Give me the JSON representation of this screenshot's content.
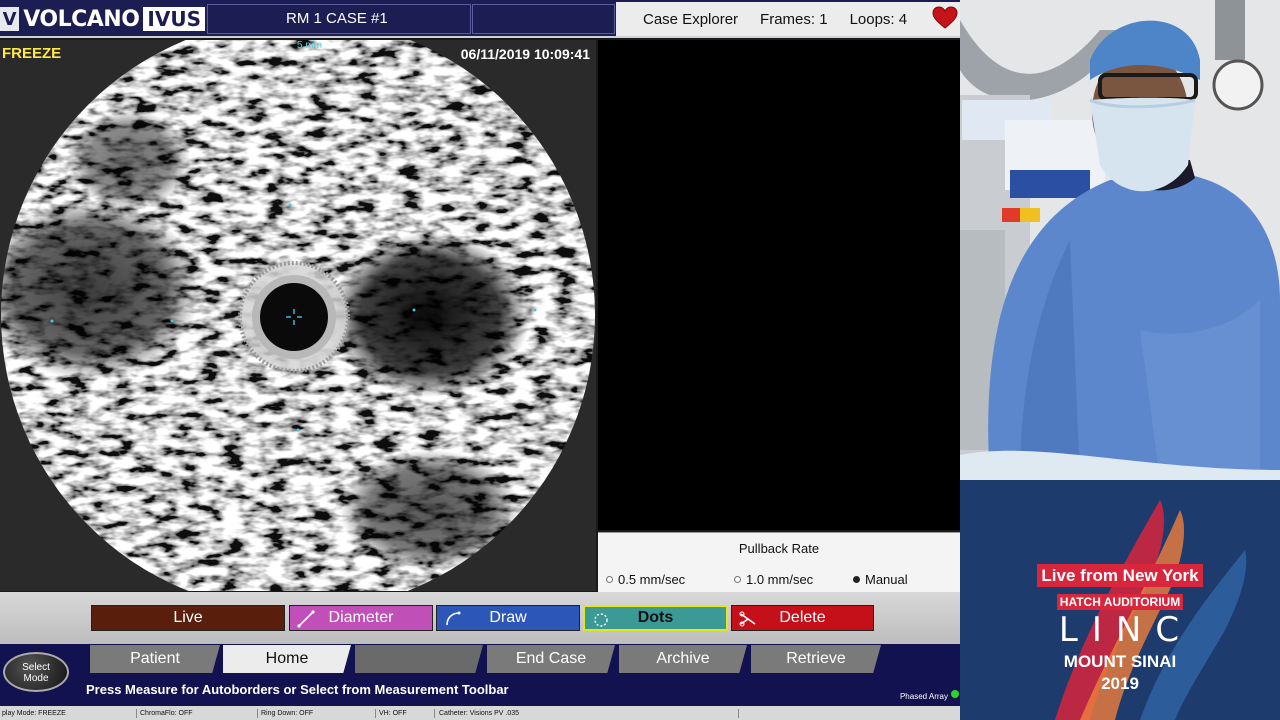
{
  "header": {
    "logo_badge": "V",
    "brand": "VOLCANO",
    "product": "IVUS",
    "case_title": "RM 1 CASE #1",
    "case_explorer_label": "Case Explorer",
    "frames_label": "Frames: 1",
    "loops_label": "Loops: 4"
  },
  "image_panel": {
    "mode": "FREEZE",
    "scale": "5 mm",
    "timestamp": "06/11/2019 10:09:41"
  },
  "pullback": {
    "title": "Pullback Rate",
    "options": [
      {
        "label": "0.5 mm/sec",
        "selected": false
      },
      {
        "label": "1.0 mm/sec",
        "selected": false
      },
      {
        "label": "Manual",
        "selected": true
      }
    ]
  },
  "toolbar": {
    "buttons": [
      {
        "label": "Live",
        "color": "#5a1f0c"
      },
      {
        "label": "Diameter",
        "color": "#c04fb8"
      },
      {
        "label": "Draw",
        "color": "#2c57b8"
      },
      {
        "label": "Dots",
        "color": "#3b9a96",
        "highlight": "#e6e61a"
      },
      {
        "label": "Delete",
        "color": "#c5101a"
      }
    ]
  },
  "nav_tabs": [
    {
      "label": "Patient",
      "state": "normal"
    },
    {
      "label": "Home",
      "state": "active"
    },
    {
      "label": "",
      "state": "disabled"
    },
    {
      "label": "End Case",
      "state": "normal"
    },
    {
      "label": "Archive",
      "state": "normal"
    },
    {
      "label": "Retrieve",
      "state": "normal"
    }
  ],
  "select_mode_label": "Select Mode",
  "status_message": "Press Measure for Autoborders or Select from Measurement Toolbar",
  "phased_array_label": "Phased Array",
  "status_footer": {
    "display_mode": "play Mode: FREEZE",
    "chromaflo": "ChromaFlo: OFF",
    "ring_down": "Ring Down: OFF",
    "vh": "VH: OFF",
    "catheter": "Catheter: Visions PV .035"
  },
  "branding": {
    "live": "Live from New York",
    "venue": "HATCH AUDITORIUM",
    "event": "LINC",
    "site": "MOUNT SINAI",
    "year": "2019",
    "colors": {
      "navy": "#1d3b6c",
      "red": "#d8263d",
      "orange": "#f0803c"
    }
  },
  "icons": [
    "heart-icon",
    "diameter-icon",
    "draw-icon",
    "dots-icon",
    "delete-icon",
    "crosshair-icon"
  ]
}
